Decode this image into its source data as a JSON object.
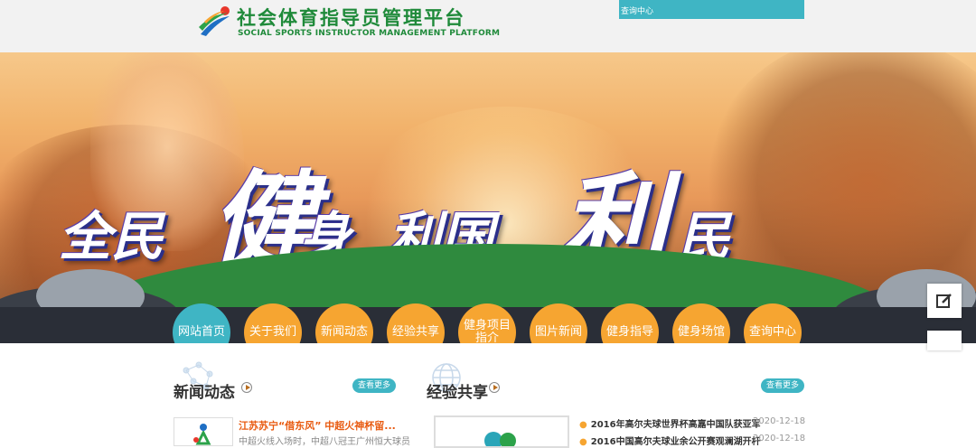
{
  "header": {
    "title": "社会体育指导员管理平台",
    "subtitle": "SOCIAL SPORTS INSTRUCTOR MANAGEMENT PLATFORM",
    "query_link": "查询中心"
  },
  "banner": {
    "slogan": [
      "全民",
      "健",
      "身",
      "利国",
      "利",
      "民"
    ]
  },
  "nav": {
    "items": [
      {
        "label": "网站首页",
        "active": true
      },
      {
        "label": "关于我们",
        "active": false
      },
      {
        "label": "新闻动态",
        "active": false
      },
      {
        "label": "经验共享",
        "active": false
      },
      {
        "label": "健身项目指介",
        "active": false
      },
      {
        "label": "图片新闻",
        "active": false
      },
      {
        "label": "健身指导",
        "active": false
      },
      {
        "label": "健身场馆",
        "active": false
      },
      {
        "label": "查询中心",
        "active": false
      }
    ]
  },
  "news": {
    "title": "新闻动态",
    "more": "查看更多",
    "items": [
      {
        "title": "江苏苏宁“借东风” 中超火神杯留...",
        "desc": "中超火线入场时，中超八冠王广州恒大球员"
      }
    ]
  },
  "experience": {
    "title": "经验共享",
    "more": "查看更多",
    "items": [
      {
        "title": "2016年高尔夫球世界杯高嘉中国队获亚军",
        "date": "2020-12-18"
      },
      {
        "title": "2016中国高尔夫球业余公开赛观澜湖开杆",
        "date": "2020-12-18"
      }
    ]
  },
  "colors": {
    "accent": "#3fb5c4",
    "orange": "#f6a531",
    "brand_green": "#1f8a3a"
  }
}
